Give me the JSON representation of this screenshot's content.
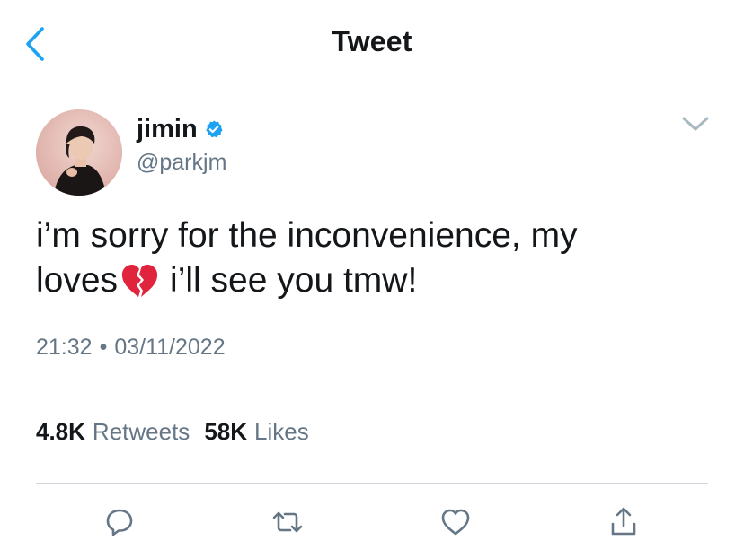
{
  "header": {
    "title": "Tweet"
  },
  "author": {
    "display_name": "jimin",
    "handle": "@parkjm",
    "verified": true
  },
  "tweet": {
    "text_line1": "i’m sorry for the inconvenience, my",
    "text_line2_before": "loves",
    "text_line2_emoji": "broken-heart-emoji",
    "text_line2_after": "i’ll see you tmw!",
    "time": "21:32",
    "separator": "•",
    "date": "03/11/2022"
  },
  "stats": {
    "retweets_count": "4.8K",
    "retweets_label": "Retweets",
    "likes_count": "58K",
    "likes_label": "Likes"
  },
  "colors": {
    "accent_blue": "#1da1f2",
    "text_primary": "#14171a",
    "text_secondary": "#657786",
    "divider": "#cfd5da",
    "emoji_red": "#e0243d"
  },
  "icons": [
    "back-chevron-icon",
    "verified-badge-icon",
    "more-caret-icon",
    "reply-icon",
    "retweet-icon",
    "like-icon",
    "share-icon"
  ]
}
